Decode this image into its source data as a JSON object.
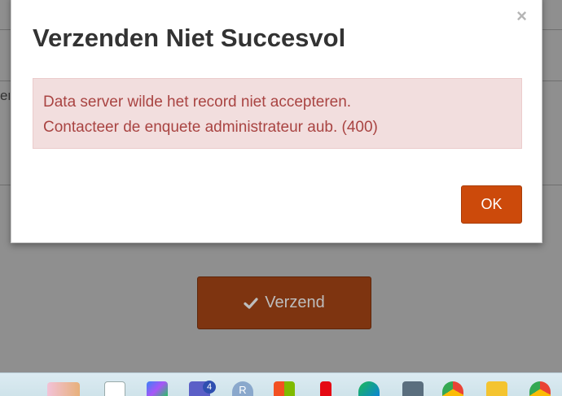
{
  "modal": {
    "title": "Verzenden Niet Succesvol",
    "close_glyph": "×",
    "alert_lines": [
      "Data server wilde het record niet accepteren.",
      "Contacteer de enquete administrateur aub. (400)"
    ],
    "ok_label": "OK"
  },
  "background": {
    "fragment_text": "er",
    "submit_label": "Verzend",
    "submit_icon": "check-icon"
  },
  "taskbar": {
    "teams_badge": "4",
    "r_label": "R",
    "icons": [
      "widgets-icon",
      "task-view-icon",
      "copilot-icon",
      "teams-icon",
      "r-app-icon",
      "store-icon",
      "netflix-icon",
      "edge-icon",
      "calculator-icon",
      "chrome-icon",
      "file-explorer-icon",
      "chrome-profile-icon"
    ]
  },
  "colors": {
    "accent": "#cc4a0b",
    "submit_dark": "#7e3410",
    "alert_bg": "#f2dede",
    "alert_text": "#a94442"
  }
}
